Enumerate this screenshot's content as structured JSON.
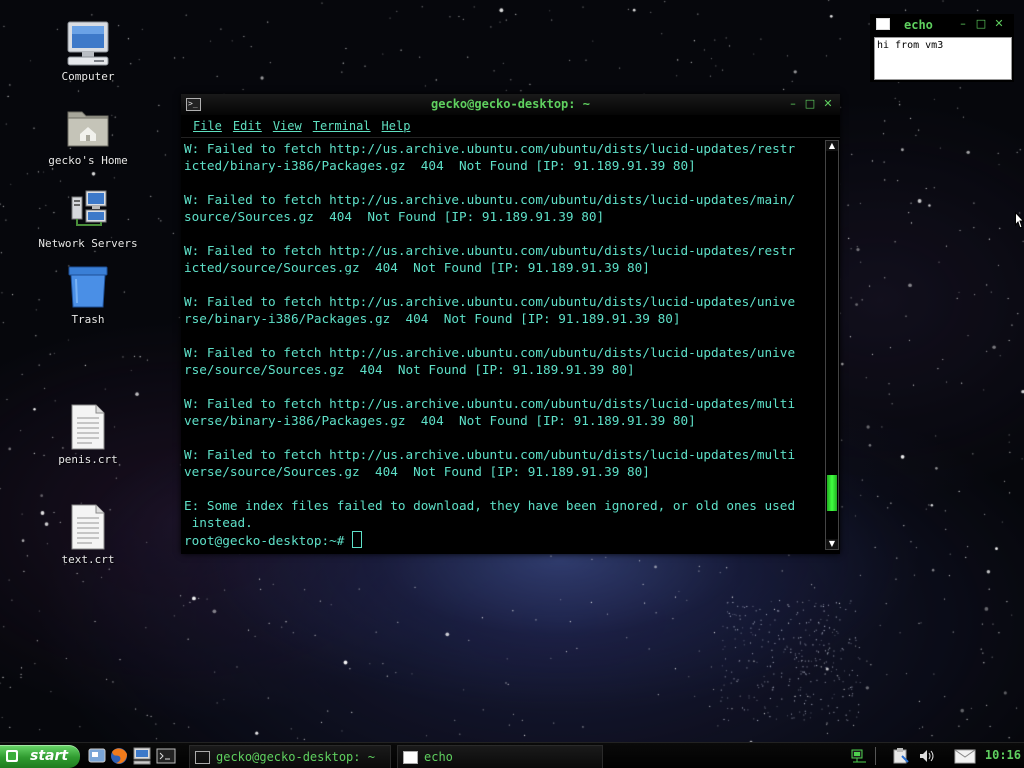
{
  "desktop": {
    "icons": [
      {
        "label": "Computer"
      },
      {
        "label": "gecko's Home"
      },
      {
        "label": "Network Servers"
      },
      {
        "label": "Trash"
      },
      {
        "label": "penis.crt"
      },
      {
        "label": "text.crt"
      }
    ]
  },
  "terminal": {
    "title": "gecko@gecko-desktop: ~",
    "menu": [
      "File",
      "Edit",
      "View",
      "Terminal",
      "Help"
    ],
    "lines": [
      "W: Failed to fetch http://us.archive.ubuntu.com/ubuntu/dists/lucid-updates/restr",
      "icted/binary-i386/Packages.gz  404  Not Found [IP: 91.189.91.39 80]",
      "",
      "W: Failed to fetch http://us.archive.ubuntu.com/ubuntu/dists/lucid-updates/main/",
      "source/Sources.gz  404  Not Found [IP: 91.189.91.39 80]",
      "",
      "W: Failed to fetch http://us.archive.ubuntu.com/ubuntu/dists/lucid-updates/restr",
      "icted/source/Sources.gz  404  Not Found [IP: 91.189.91.39 80]",
      "",
      "W: Failed to fetch http://us.archive.ubuntu.com/ubuntu/dists/lucid-updates/unive",
      "rse/binary-i386/Packages.gz  404  Not Found [IP: 91.189.91.39 80]",
      "",
      "W: Failed to fetch http://us.archive.ubuntu.com/ubuntu/dists/lucid-updates/unive",
      "rse/source/Sources.gz  404  Not Found [IP: 91.189.91.39 80]",
      "",
      "W: Failed to fetch http://us.archive.ubuntu.com/ubuntu/dists/lucid-updates/multi",
      "verse/binary-i386/Packages.gz  404  Not Found [IP: 91.189.91.39 80]",
      "",
      "W: Failed to fetch http://us.archive.ubuntu.com/ubuntu/dists/lucid-updates/multi",
      "verse/source/Sources.gz  404  Not Found [IP: 91.189.91.39 80]",
      "",
      "E: Some index files failed to download, they have been ignored, or old ones used",
      " instead."
    ],
    "prompt": "root@gecko-desktop:~# ",
    "scroll_position": 0.92,
    "text_color": "#5ee0c8",
    "title_color": "#5fd05f"
  },
  "echo_window": {
    "title": "echo",
    "content": "hi from vm3"
  },
  "taskbar": {
    "start_label": "start",
    "tasks": [
      {
        "label": "gecko@gecko-desktop: ~",
        "icon": "terminal-icon"
      },
      {
        "label": "echo",
        "icon": "window-icon"
      }
    ],
    "clock": "10:16",
    "accent_color": "#3cae3c"
  }
}
